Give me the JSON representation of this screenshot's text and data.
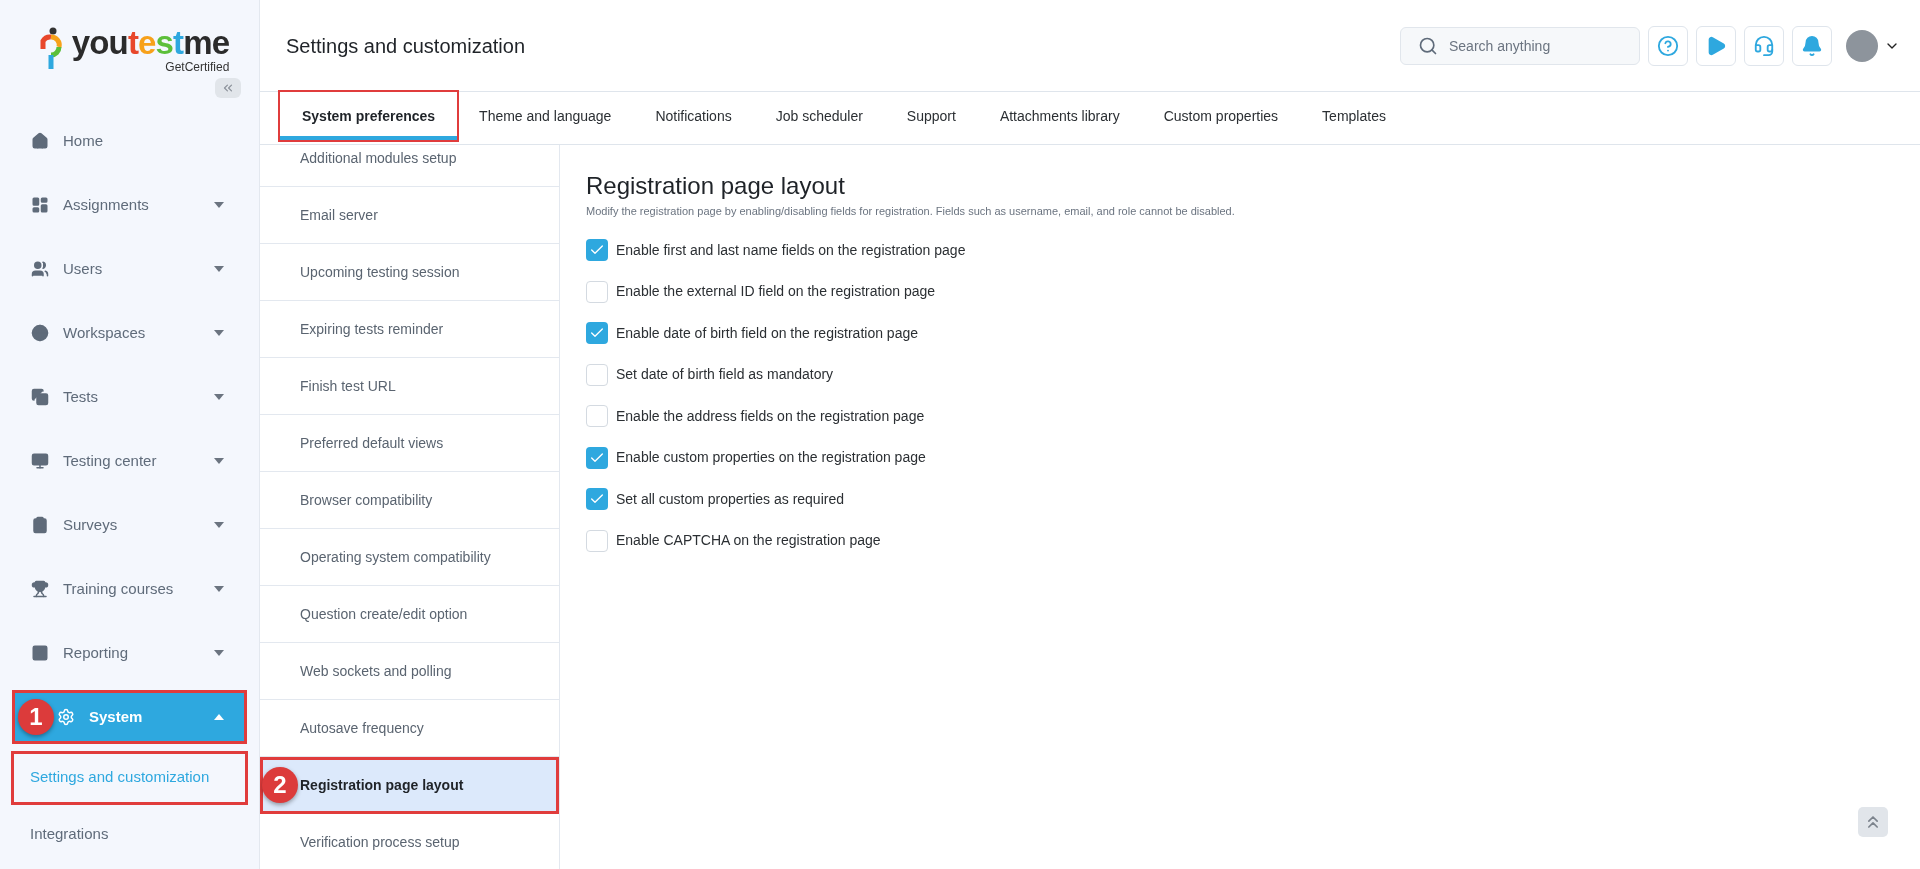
{
  "logo": {
    "parts": [
      {
        "text": "you",
        "color": "#2b2b2b"
      },
      {
        "text": "t",
        "color": "#e8472b"
      },
      {
        "text": "e",
        "color": "#f7a11a"
      },
      {
        "text": "s",
        "color": "#5cbf3a"
      },
      {
        "text": "t",
        "color": "#2ea8df"
      },
      {
        "text": "me",
        "color": "#2b2b2b"
      }
    ],
    "tagline": "GetCertified"
  },
  "sidebar": {
    "items": [
      {
        "label": "Home",
        "kind": "link",
        "expanded": false,
        "outlined": false
      },
      {
        "label": "Assignments",
        "kind": "group",
        "expanded": false,
        "outlined": false
      },
      {
        "label": "Users",
        "kind": "group",
        "expanded": false,
        "outlined": false
      },
      {
        "label": "Workspaces",
        "kind": "group",
        "expanded": false,
        "outlined": false
      },
      {
        "label": "Tests",
        "kind": "group",
        "expanded": false,
        "outlined": false
      },
      {
        "label": "Testing center",
        "kind": "group",
        "expanded": false,
        "outlined": false
      },
      {
        "label": "Surveys",
        "kind": "group",
        "expanded": false,
        "outlined": false
      },
      {
        "label": "Training courses",
        "kind": "group",
        "expanded": false,
        "outlined": false
      },
      {
        "label": "Reporting",
        "kind": "group",
        "expanded": false,
        "outlined": false
      },
      {
        "label": "System",
        "kind": "group",
        "expanded": true,
        "outlined": true,
        "badge": "1",
        "children": [
          {
            "label": "Settings and customization",
            "selected": true,
            "outlined": true
          },
          {
            "label": "Integrations",
            "selected": false,
            "outlined": false
          }
        ]
      }
    ]
  },
  "header": {
    "title": "Settings and customization",
    "search": {
      "placeholder": "Search anything"
    }
  },
  "tabs": [
    {
      "label": "System preferences",
      "selected": true,
      "outlined": true
    },
    {
      "label": "Theme and language",
      "selected": false,
      "outlined": false
    },
    {
      "label": "Notifications",
      "selected": false,
      "outlined": false
    },
    {
      "label": "Job scheduler",
      "selected": false,
      "outlined": false
    },
    {
      "label": "Support",
      "selected": false,
      "outlined": false
    },
    {
      "label": "Attachments library",
      "selected": false,
      "outlined": false
    },
    {
      "label": "Custom properties",
      "selected": false,
      "outlined": false
    },
    {
      "label": "Templates",
      "selected": false,
      "outlined": false
    }
  ],
  "settings_menu": [
    {
      "label": "Additional modules setup",
      "selected": false,
      "outlined": false
    },
    {
      "label": "Email server",
      "selected": false,
      "outlined": false
    },
    {
      "label": "Upcoming testing session",
      "selected": false,
      "outlined": false
    },
    {
      "label": "Expiring tests reminder",
      "selected": false,
      "outlined": false
    },
    {
      "label": "Finish test URL",
      "selected": false,
      "outlined": false
    },
    {
      "label": "Preferred default views",
      "selected": false,
      "outlined": false
    },
    {
      "label": "Browser compatibility",
      "selected": false,
      "outlined": false
    },
    {
      "label": "Operating system compatibility",
      "selected": false,
      "outlined": false
    },
    {
      "label": "Question create/edit option",
      "selected": false,
      "outlined": false
    },
    {
      "label": "Web sockets and polling",
      "selected": false,
      "outlined": false
    },
    {
      "label": "Autosave frequency",
      "selected": false,
      "outlined": false
    },
    {
      "label": "Registration page layout",
      "selected": true,
      "outlined": true,
      "badge": "2"
    },
    {
      "label": "Verification process setup",
      "selected": false,
      "outlined": false
    }
  ],
  "panel": {
    "title": "Registration page layout",
    "description": "Modify the registration page by enabling/disabling fields for registration. Fields such as username, email, and role cannot be disabled.",
    "options": [
      {
        "label": "Enable first and last name fields on the registration page",
        "checked": true
      },
      {
        "label": "Enable the external ID field on the registration page",
        "checked": false
      },
      {
        "label": "Enable date of birth field on the registration page",
        "checked": true
      },
      {
        "label": "Set date of birth field as mandatory",
        "checked": false
      },
      {
        "label": "Enable the address fields on the registration page",
        "checked": false
      },
      {
        "label": "Enable custom properties on the registration page",
        "checked": true
      },
      {
        "label": "Set all custom properties as required",
        "checked": true
      },
      {
        "label": "Enable CAPTCHA on the registration page",
        "checked": false
      }
    ]
  }
}
